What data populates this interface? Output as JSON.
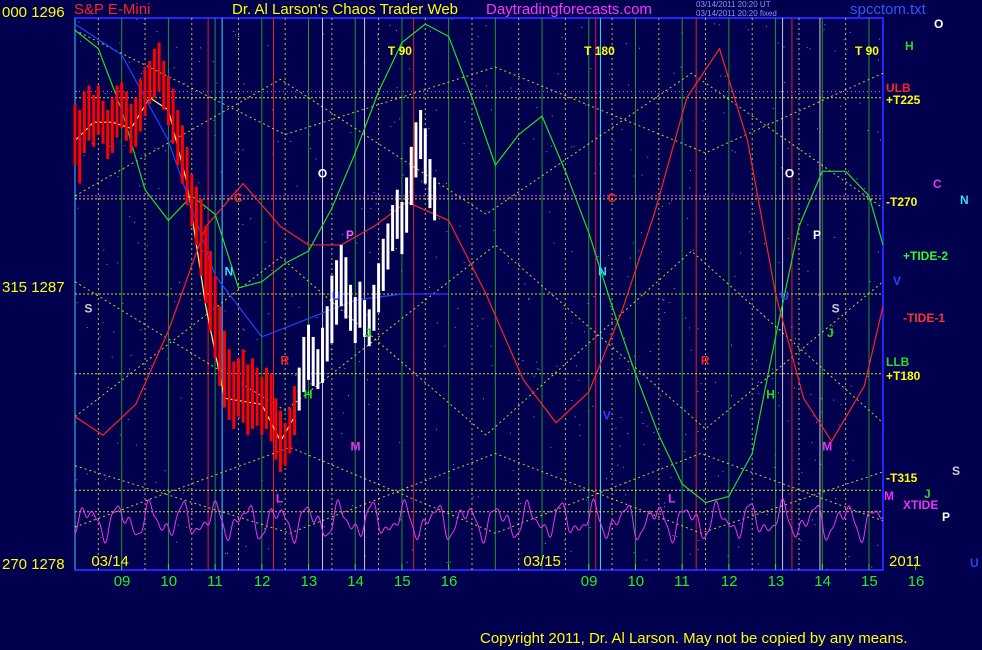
{
  "header": {
    "instrument": "S&P E-Mini",
    "publisher": "Dr. Al Larson's Chaos Trader Web",
    "website": "Daytradingforecasts.com",
    "filename": "spcctom.txt",
    "stamp_line_1": "03/14/2011 20:20 UT",
    "stamp_line_2": "03/14/2011 20:20 fixed"
  },
  "copyright": "Copyright 2011, Dr. Al Larson. May not be copied by any means.",
  "colors": {
    "background": "#00004e",
    "frame": "#2222ff",
    "price_bars_day1": "#ff0000",
    "price_bars_day2": "#ffffff",
    "average_line": "#ffff66",
    "tide_1": "#ff2222",
    "tide_2": "#22dd22",
    "xtide": "#ee33ee",
    "grid_yellow": "#ffff33",
    "grid_green": "#22cc22",
    "grid_red": "#dd2222",
    "grid_cyan": "#33ddff",
    "grid_white": "#ffffff"
  },
  "chart_data": {
    "type": "line",
    "title": "S&P E-Mini",
    "y_axis_left_labels": [
      {
        "value": 1296,
        "label": "000  1296"
      },
      {
        "value": 1287,
        "label": "315  1287"
      },
      {
        "value": 1278,
        "label": "270  1278"
      }
    ],
    "ylim": [
      1278,
      1296
    ],
    "date_labels": [
      "03/14",
      "03/15"
    ],
    "year_label": "2011",
    "x_ticks": [
      "09",
      "10",
      "11",
      "12",
      "13",
      "14",
      "15",
      "16",
      "09",
      "10",
      "11",
      "12",
      "13",
      "14",
      "15",
      "16"
    ],
    "time_markers": [
      "T 90",
      "T 180",
      "T 90"
    ],
    "right_labels": [
      {
        "text": "O",
        "color": "#ffffff"
      },
      {
        "text": "H",
        "color": "#22dd22"
      },
      {
        "text": "ULB",
        "color": "#ff2222"
      },
      {
        "text": "+T225",
        "color": "#ffff00"
      },
      {
        "text": "-T270",
        "color": "#ffff00"
      },
      {
        "text": "C",
        "color": "#ee33ee"
      },
      {
        "text": "N",
        "color": "#33ddff"
      },
      {
        "text": "+TIDE-2",
        "color": "#22ff22"
      },
      {
        "text": "V",
        "color": "#2244ff"
      },
      {
        "text": "-TIDE-1",
        "color": "#ff3333"
      },
      {
        "text": "LLB",
        "color": "#22dd22"
      },
      {
        "text": "+T180",
        "color": "#ffff00"
      },
      {
        "text": "S",
        "color": "#cccccc"
      },
      {
        "text": "-T315",
        "color": "#ffff00"
      },
      {
        "text": "M",
        "color": "#ee33ee"
      },
      {
        "text": "J",
        "color": "#22dd22"
      },
      {
        "text": "XTIDE",
        "color": "#ee33ee"
      },
      {
        "text": "P",
        "color": "#ffffff"
      },
      {
        "text": "U",
        "color": "#2244ff"
      }
    ],
    "planet_markers": [
      {
        "text": "O",
        "color": "#ffffff",
        "x": 13.2,
        "y": 1290.8
      },
      {
        "text": "O",
        "color": "#ffffff",
        "x": 23.2,
        "y": 1290.8
      },
      {
        "text": "C",
        "color": "#ff2222",
        "x": 11.4,
        "y": 1290.0
      },
      {
        "text": "C",
        "color": "#ff2222",
        "x": 19.4,
        "y": 1290.0
      },
      {
        "text": "N",
        "color": "#33ddff",
        "x": 11.2,
        "y": 1287.6
      },
      {
        "text": "N",
        "color": "#33ddff",
        "x": 19.2,
        "y": 1287.6
      },
      {
        "text": "P",
        "color": "#ff55ff",
        "x": 13.8,
        "y": 1288.8
      },
      {
        "text": "P",
        "color": "#ffffff",
        "x": 23.8,
        "y": 1288.8
      },
      {
        "text": "S",
        "color": "#cccccc",
        "x": 8.2,
        "y": 1286.4
      },
      {
        "text": "S",
        "color": "#cccccc",
        "x": 24.2,
        "y": 1286.4
      },
      {
        "text": "U",
        "color": "#2244ff",
        "x": 13.5,
        "y": 1286.8
      },
      {
        "text": "U",
        "color": "#2244ff",
        "x": 23.1,
        "y": 1286.8
      },
      {
        "text": "J",
        "color": "#22dd22",
        "x": 14.2,
        "y": 1285.6
      },
      {
        "text": "J",
        "color": "#22dd22",
        "x": 24.1,
        "y": 1285.6
      },
      {
        "text": "R",
        "color": "#ff2222",
        "x": 12.4,
        "y": 1284.7
      },
      {
        "text": "R",
        "color": "#ff2222",
        "x": 21.4,
        "y": 1284.7
      },
      {
        "text": "H",
        "color": "#22dd22",
        "x": 12.9,
        "y": 1283.6
      },
      {
        "text": "H",
        "color": "#22dd22",
        "x": 22.8,
        "y": 1283.6
      },
      {
        "text": "V",
        "color": "#2244ff",
        "x": 19.3,
        "y": 1282.9
      },
      {
        "text": "M",
        "color": "#ee33ee",
        "x": 13.9,
        "y": 1281.9
      },
      {
        "text": "M",
        "color": "#ee33ee",
        "x": 24.0,
        "y": 1281.9
      },
      {
        "text": "L",
        "color": "#ee33ee",
        "x": 12.3,
        "y": 1280.2
      },
      {
        "text": "L",
        "color": "#ee33ee",
        "x": 20.7,
        "y": 1280.2
      }
    ],
    "series": [
      {
        "name": "S&P E-Mini 03/14",
        "kind": "price_bars",
        "bars": [
          [
            8.0,
            1293.2,
            1291.2
          ],
          [
            8.1,
            1293.0,
            1290.6
          ],
          [
            8.2,
            1293.6,
            1291.6
          ],
          [
            8.3,
            1293.8,
            1292.0
          ],
          [
            8.4,
            1293.5,
            1291.8
          ],
          [
            8.5,
            1293.8,
            1292.2
          ],
          [
            8.6,
            1293.3,
            1291.9
          ],
          [
            8.7,
            1293.0,
            1291.4
          ],
          [
            8.8,
            1293.4,
            1291.6
          ],
          [
            8.9,
            1293.8,
            1292.1
          ],
          [
            9.0,
            1293.9,
            1292.4
          ],
          [
            9.1,
            1293.6,
            1292.0
          ],
          [
            9.2,
            1293.2,
            1291.6
          ],
          [
            9.3,
            1293.4,
            1291.8
          ],
          [
            9.4,
            1294.0,
            1292.3
          ],
          [
            9.5,
            1294.4,
            1292.8
          ],
          [
            9.6,
            1294.6,
            1293.2
          ],
          [
            9.7,
            1295.0,
            1293.4
          ],
          [
            9.8,
            1295.2,
            1293.6
          ],
          [
            9.9,
            1294.6,
            1293.0
          ],
          [
            10.0,
            1294.1,
            1292.5
          ],
          [
            10.1,
            1293.7,
            1291.9
          ],
          [
            10.2,
            1293.0,
            1291.2
          ],
          [
            10.3,
            1292.5,
            1290.6
          ],
          [
            10.4,
            1291.8,
            1289.9
          ],
          [
            10.5,
            1290.9,
            1289.2
          ],
          [
            10.6,
            1290.5,
            1288.6
          ],
          [
            10.7,
            1290.1,
            1287.6
          ],
          [
            10.8,
            1289.2,
            1286.7
          ],
          [
            10.9,
            1288.4,
            1285.8
          ],
          [
            11.0,
            1287.6,
            1284.9
          ],
          [
            11.1,
            1286.6,
            1284.0
          ],
          [
            11.2,
            1285.8,
            1283.3
          ],
          [
            11.3,
            1285.2,
            1282.9
          ],
          [
            11.4,
            1284.8,
            1282.6
          ],
          [
            11.5,
            1284.9,
            1283.0
          ],
          [
            11.6,
            1285.2,
            1282.8
          ],
          [
            11.7,
            1284.7,
            1282.4
          ],
          [
            11.8,
            1284.9,
            1282.6
          ],
          [
            11.9,
            1284.6,
            1282.7
          ],
          [
            12.0,
            1284.3,
            1282.4
          ],
          [
            12.1,
            1284.6,
            1282.6
          ],
          [
            12.2,
            1284.4,
            1282.2
          ],
          [
            12.3,
            1283.6,
            1281.6
          ],
          [
            12.4,
            1283.2,
            1281.2
          ],
          [
            12.5,
            1282.8,
            1281.4
          ],
          [
            12.6,
            1283.3,
            1281.8
          ],
          [
            12.7,
            1284.0,
            1282.4
          ]
        ]
      },
      {
        "name": "S&P E-Mini 03/15",
        "kind": "price_bars",
        "bars": [
          [
            12.8,
            1284.6,
            1283.2
          ],
          [
            12.9,
            1285.6,
            1283.8
          ],
          [
            13.0,
            1286.0,
            1284.2
          ],
          [
            13.1,
            1285.6,
            1284.0
          ],
          [
            13.2,
            1285.2,
            1283.9
          ],
          [
            13.3,
            1285.9,
            1284.1
          ],
          [
            13.4,
            1286.6,
            1284.8
          ],
          [
            13.5,
            1287.6,
            1285.4
          ],
          [
            13.6,
            1288.1,
            1286.0
          ],
          [
            13.7,
            1288.6,
            1286.6
          ],
          [
            13.8,
            1288.2,
            1286.2
          ],
          [
            13.9,
            1287.3,
            1285.8
          ],
          [
            14.0,
            1286.9,
            1285.4
          ],
          [
            14.1,
            1287.4,
            1285.9
          ],
          [
            14.2,
            1286.8,
            1285.6
          ],
          [
            14.3,
            1286.5,
            1285.3
          ],
          [
            14.4,
            1287.3,
            1285.8
          ],
          [
            14.5,
            1288.0,
            1286.4
          ],
          [
            14.6,
            1288.8,
            1287.1
          ],
          [
            14.7,
            1289.3,
            1287.8
          ],
          [
            14.8,
            1289.9,
            1288.4
          ],
          [
            14.9,
            1290.4,
            1288.8
          ],
          [
            15.0,
            1290.0,
            1288.3
          ],
          [
            15.1,
            1290.8,
            1289.0
          ],
          [
            15.2,
            1291.8,
            1289.9
          ],
          [
            15.3,
            1292.6,
            1290.8
          ],
          [
            15.4,
            1293.0,
            1291.4
          ],
          [
            15.5,
            1292.4,
            1290.6
          ],
          [
            15.6,
            1291.4,
            1289.8
          ],
          [
            15.7,
            1290.8,
            1289.4
          ]
        ]
      },
      {
        "name": "average",
        "kind": "line",
        "x": [
          8.0,
          8.4,
          8.8,
          9.2,
          9.6,
          10.0,
          10.4,
          10.8,
          11.2,
          11.6,
          12.0,
          12.4,
          12.7
        ],
        "y": [
          1292.0,
          1292.6,
          1292.6,
          1292.4,
          1293.4,
          1293.0,
          1290.6,
          1286.6,
          1283.6,
          1283.5,
          1283.4,
          1282.2,
          1283.0
        ]
      },
      {
        "name": "TIDE-1",
        "kind": "line",
        "x": [
          8.0,
          8.6,
          9.3,
          10.0,
          10.8,
          11.6,
          12.4,
          13.0,
          13.7,
          14.4,
          15.1,
          16.0,
          16.8,
          17.6,
          18.3,
          19.0,
          19.7,
          20.4,
          21.1,
          21.8,
          22.4,
          23.0,
          23.6,
          24.2,
          24.9,
          25.3
        ],
        "y": [
          1283.0,
          1282.4,
          1283.4,
          1285.8,
          1289.2,
          1290.6,
          1289.2,
          1288.6,
          1288.6,
          1289.2,
          1290.0,
          1289.4,
          1287.0,
          1284.2,
          1282.8,
          1283.8,
          1286.4,
          1289.6,
          1293.4,
          1295.0,
          1292.0,
          1287.0,
          1283.6,
          1282.2,
          1284.0,
          1286.6
        ]
      },
      {
        "name": "TIDE-2",
        "kind": "line",
        "x": [
          8.0,
          8.5,
          9.0,
          9.5,
          10.0,
          10.5,
          11.0,
          11.5,
          12.0,
          12.5,
          13.0,
          13.5,
          14.0,
          14.5,
          15.0,
          15.5,
          16.0,
          16.5,
          17.0,
          17.5,
          18.0,
          18.5,
          19.0,
          19.5,
          20.0,
          20.5,
          21.0,
          21.5,
          22.0,
          22.5,
          23.0,
          23.5,
          24.0,
          24.5,
          25.0,
          25.3
        ],
        "y": [
          1295.6,
          1295.0,
          1293.0,
          1290.4,
          1289.4,
          1290.2,
          1289.6,
          1287.2,
          1287.4,
          1288.0,
          1288.4,
          1289.8,
          1291.6,
          1293.6,
          1295.2,
          1295.8,
          1295.4,
          1293.4,
          1291.2,
          1292.2,
          1292.8,
          1291.0,
          1289.0,
          1286.6,
          1284.4,
          1282.4,
          1280.8,
          1280.2,
          1280.4,
          1281.8,
          1285.6,
          1289.2,
          1291.0,
          1291.0,
          1290.2,
          1288.6
        ]
      },
      {
        "name": "blue trend",
        "kind": "line",
        "x": [
          8.0,
          9.0,
          10.0,
          11.0,
          12.0,
          13.0,
          14.0,
          15.0,
          16.0
        ],
        "y": [
          1295.8,
          1294.8,
          1292.0,
          1287.6,
          1285.6,
          1286.2,
          1286.8,
          1287.0,
          1287.0
        ]
      }
    ],
    "xtide": {
      "name": "XTIDE",
      "baseline": 1279.6,
      "amplitude": 0.75
    },
    "grid": true,
    "legend": "none"
  }
}
